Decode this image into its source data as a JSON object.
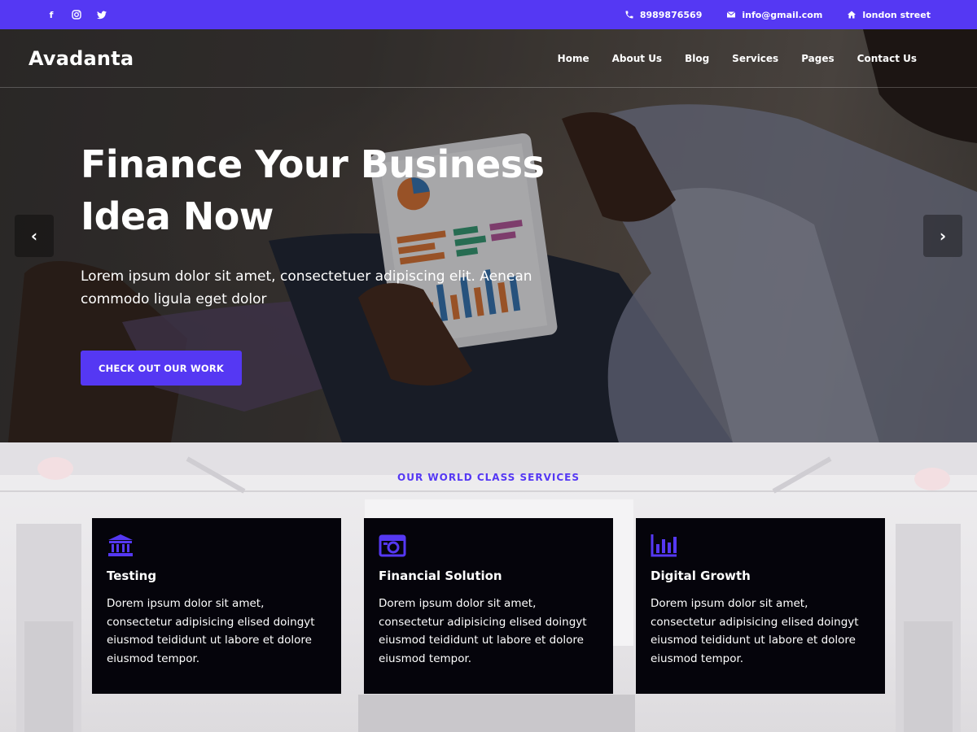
{
  "topbar": {
    "social": [
      "facebook-icon",
      "instagram-icon",
      "twitter-icon"
    ],
    "phone": "8989876569",
    "email": "info@gmail.com",
    "address": "london street"
  },
  "nav": {
    "brand": "Avadanta",
    "items": [
      {
        "label": "Home"
      },
      {
        "label": "About Us"
      },
      {
        "label": "Blog"
      },
      {
        "label": "Services"
      },
      {
        "label": "Pages"
      },
      {
        "label": "Contact Us"
      }
    ]
  },
  "hero": {
    "title_line1": "Finance Your Business",
    "title_line2": "Idea Now",
    "subtitle": "Lorem ipsum dolor sit amet, consectetuer adipiscing elit. Aenean commodo ligula eget dolor",
    "cta": "CHECK OUT OUR WORK"
  },
  "services": {
    "heading": "OUR WORLD CLASS SERVICES",
    "cards": [
      {
        "icon": "bank-icon",
        "title": "Testing",
        "text": "Dorem ipsum dolor sit amet, consectetur adipisicing elised doingyt eiusmod teididunt ut labore et dolore eiusmod tempor."
      },
      {
        "icon": "camera-icon",
        "title": "Financial Solution",
        "text": "Dorem ipsum dolor sit amet, consectetur adipisicing elised doingyt eiusmod teididunt ut labore et dolore eiusmod tempor."
      },
      {
        "icon": "bar-chart-icon",
        "title": "Digital Growth",
        "text": "Dorem ipsum dolor sit amet, consectetur adipisicing elised doingyt eiusmod teididunt ut labore et dolore eiusmod tempor."
      }
    ]
  },
  "colors": {
    "accent": "#5538f3",
    "card_bg": "#05040b"
  }
}
